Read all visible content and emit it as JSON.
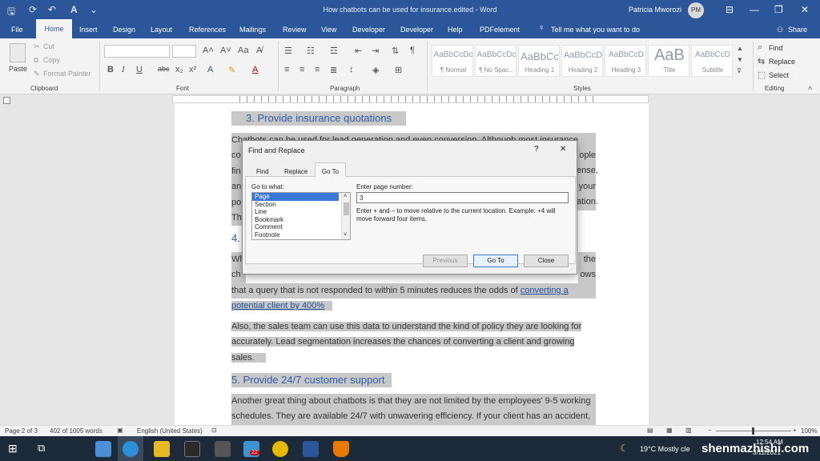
{
  "window": {
    "title": "How chatbots can be used for insurance.edited  -  Word",
    "user": "Patricia Mworozi",
    "user_initials": "PM",
    "autosave_icon": "save-icon",
    "controls": [
      "minimize",
      "restore",
      "close"
    ]
  },
  "tabs": [
    "File",
    "Home",
    "Insert",
    "Design",
    "Layout",
    "References",
    "Mailings",
    "Review",
    "View",
    "Developer",
    "Developer",
    "Help",
    "PDFelement"
  ],
  "tell_me": "Tell me what you want to do",
  "share": "Share",
  "ribbon": {
    "clipboard": {
      "label": "Clipboard",
      "paste": "Paste",
      "cut": "Cut",
      "copy": "Copy",
      "format_painter": "Format Painter"
    },
    "font": {
      "label": "Font"
    },
    "paragraph": {
      "label": "Paragraph"
    },
    "styles": {
      "label": "Styles",
      "items": [
        {
          "sample": "AaBbCcDc",
          "name": "¶ Normal"
        },
        {
          "sample": "AaBbCcDc",
          "name": "¶ No Spac..."
        },
        {
          "sample": "AaBbCc",
          "name": "Heading 1"
        },
        {
          "sample": "AaBbCcD",
          "name": "Heading 2"
        },
        {
          "sample": "AaBbCcD",
          "name": "Heading 3"
        },
        {
          "sample": "AaB",
          "name": "Title"
        },
        {
          "sample": "AaBbCcD",
          "name": "Subtitle"
        }
      ]
    },
    "editing": {
      "label": "Editing",
      "find": "Find",
      "replace": "Replace",
      "select": "Select"
    }
  },
  "document": {
    "heading3": "3.  Provide insurance quotations",
    "p1_lines": [
      "Chatbots can be used for lead generation and even conversion. Although most insurance",
      "co",
      "fin",
      "an",
      "po",
      "Th"
    ],
    "p1_right": [
      "ople",
      "ense,",
      "your",
      "ation."
    ],
    "heading4": "4.",
    "p2_start": "Wh",
    "p2_right": "the",
    "p2_line2": "ch",
    "p2_line2_right": "ows",
    "p2_line3": "that a query that is not responded to within 5 minutes reduces the odds of",
    "p2_link1": "converting a",
    "p2_link2": "potential client by 400%",
    "p3_lines": [
      "Also, the sales team can use this data to understand the kind of policy they are looking for",
      "accurately. Lead segmentation increases the chances of converting a client and growing",
      "sales."
    ],
    "heading5": "5.  Provide 24/7 customer support",
    "p4_lines": [
      "Another great thing about chatbots is that they are not limited by the employees' 9-5 working",
      "schedules. They are available 24/7 with unwavering efficiency. If your client has an accident,"
    ]
  },
  "dialog": {
    "title": "Find and Replace",
    "help": "?",
    "close": "✕",
    "tabs": [
      "Find",
      "Replace",
      "Go To"
    ],
    "active_tab": "Go To",
    "go_to_what_label": "Go to what:",
    "go_to_items": [
      "Page",
      "Section",
      "Line",
      "Bookmark",
      "Comment",
      "Footnote"
    ],
    "selected_item": "Page",
    "enter_label": "Enter page number:",
    "page_value": "3",
    "hint": "Enter + and – to move relative to the current location. Example: +4 will move forward four items.",
    "buttons": {
      "previous": "Previous",
      "goto": "Go To",
      "close": "Close"
    }
  },
  "status": {
    "page": "Page 2 of 3",
    "words": "402 of 1005 words",
    "language": "English (United States)",
    "zoom": "100%"
  },
  "taskbar": {
    "weather": "19°C  Mostly cle",
    "time": "12:54 AM",
    "date": "3/11/2021",
    "badge": "22",
    "watermark": "shenmazhishi.com"
  }
}
